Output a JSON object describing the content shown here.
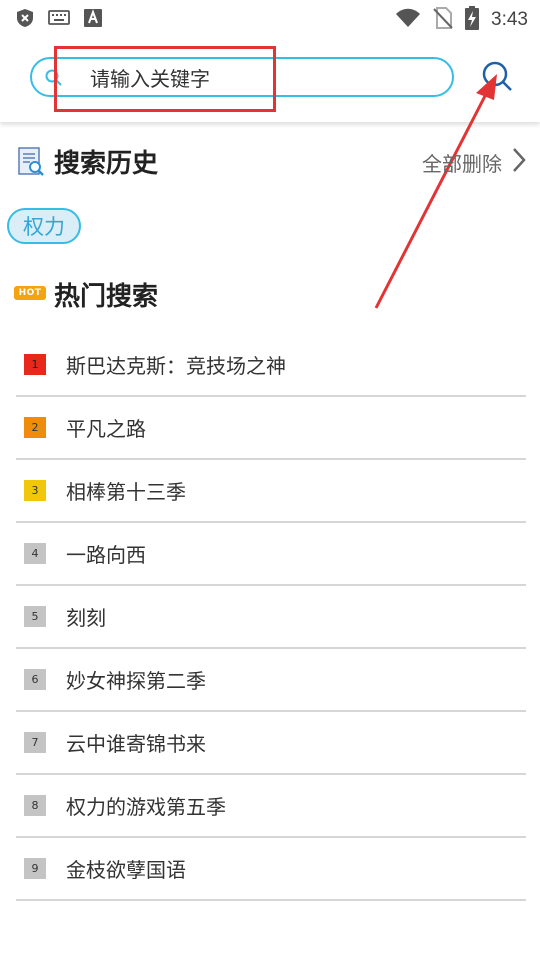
{
  "status_bar": {
    "time": "3:43"
  },
  "search": {
    "placeholder": "请输入关键字"
  },
  "history": {
    "title": "搜索历史",
    "clear_label": "全部删除",
    "tags": [
      "权力"
    ]
  },
  "hot": {
    "badge": "HOT",
    "title": "热门搜索",
    "items": [
      {
        "rank": "1",
        "label": "斯巴达克斯：竞技场之神"
      },
      {
        "rank": "2",
        "label": "平凡之路"
      },
      {
        "rank": "3",
        "label": "相棒第十三季"
      },
      {
        "rank": "4",
        "label": "一路向西"
      },
      {
        "rank": "5",
        "label": "刻刻"
      },
      {
        "rank": "6",
        "label": "妙女神探第二季"
      },
      {
        "rank": "7",
        "label": "云中谁寄锦书来"
      },
      {
        "rank": "8",
        "label": "权力的游戏第五季"
      },
      {
        "rank": "9",
        "label": "金枝欲孽国语"
      }
    ]
  },
  "colors": {
    "accent": "#35bde6",
    "annotation": "#e23434",
    "rank1": "#e8281a",
    "rank2": "#f08c0b",
    "rank3": "#f1c70b",
    "rank_default": "#c4c4c4"
  },
  "icons": [
    "shield-icon",
    "keyboard-icon",
    "font-icon",
    "wifi-icon",
    "no-sim-icon",
    "battery-charging-icon",
    "search-icon",
    "history-document-icon",
    "chevron-right-icon"
  ]
}
